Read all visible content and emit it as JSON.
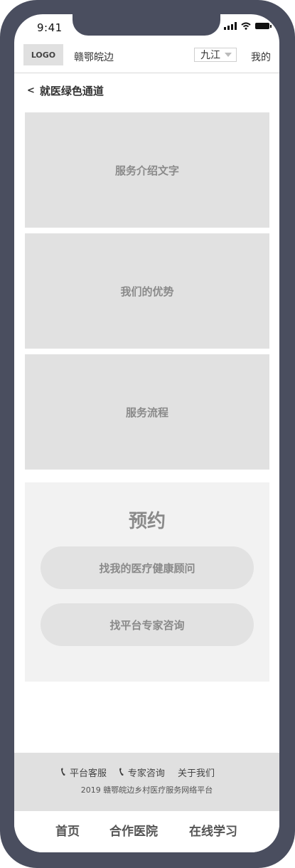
{
  "status_bar": {
    "time": "9:41"
  },
  "navbar": {
    "logo": "LOGO",
    "brand": "赣鄂皖边",
    "city": "九江",
    "mine": "我的"
  },
  "page": {
    "back": "<",
    "title": "就医绿色通道"
  },
  "sections": [
    {
      "label": "服务介绍文字"
    },
    {
      "label": "我们的优势"
    },
    {
      "label": "服务流程"
    }
  ],
  "booking": {
    "title": "预约",
    "buttons": [
      {
        "label": "找我的医疗健康顾问"
      },
      {
        "label": "找平台专家咨询"
      }
    ]
  },
  "footer": {
    "links": [
      {
        "label": "平台客服"
      },
      {
        "label": "专家咨询"
      },
      {
        "label": "关于我们"
      }
    ],
    "copyright": "2019 赣鄂皖边乡村医疗服务网络平台"
  },
  "tabs": [
    {
      "label": "首页"
    },
    {
      "label": "合作医院"
    },
    {
      "label": "在线学习"
    }
  ]
}
